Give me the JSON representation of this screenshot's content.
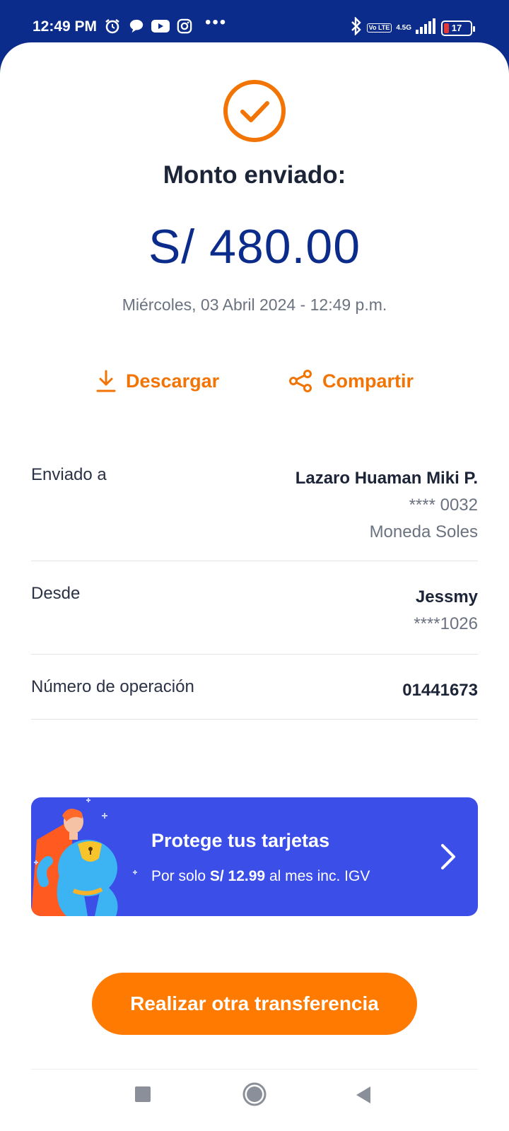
{
  "status_bar": {
    "time": "12:49 PM",
    "network_badge": "Vo LTE",
    "network_type": "4.5G",
    "battery": "17",
    "more": "•••"
  },
  "receipt": {
    "title": "Monto enviado:",
    "amount": "S/ 480.00",
    "datetime": "Miércoles, 03 Abril 2024 - 12:49 p.m."
  },
  "actions": {
    "download_label": "Descargar",
    "share_label": "Compartir"
  },
  "details": {
    "sent_to_label": "Enviado a",
    "sent_to_name": "Lazaro Huaman Miki P.",
    "sent_to_account": "**** 0032",
    "sent_to_currency": "Moneda Soles",
    "from_label": "Desde",
    "from_name": "Jessmy",
    "from_account": "****1026",
    "operation_label": "Número de operación",
    "operation_number": "01441673"
  },
  "promo": {
    "title": "Protege tus tarjetas",
    "sub_prefix": "Por solo ",
    "sub_price": "S/ 12.99",
    "sub_suffix": " al mes inc. IGV"
  },
  "cta_label": "Realizar otra transferencia",
  "colors": {
    "primary_blue": "#0b2c8a",
    "accent_orange": "#f27405",
    "promo_blue": "#3b4ee8"
  }
}
